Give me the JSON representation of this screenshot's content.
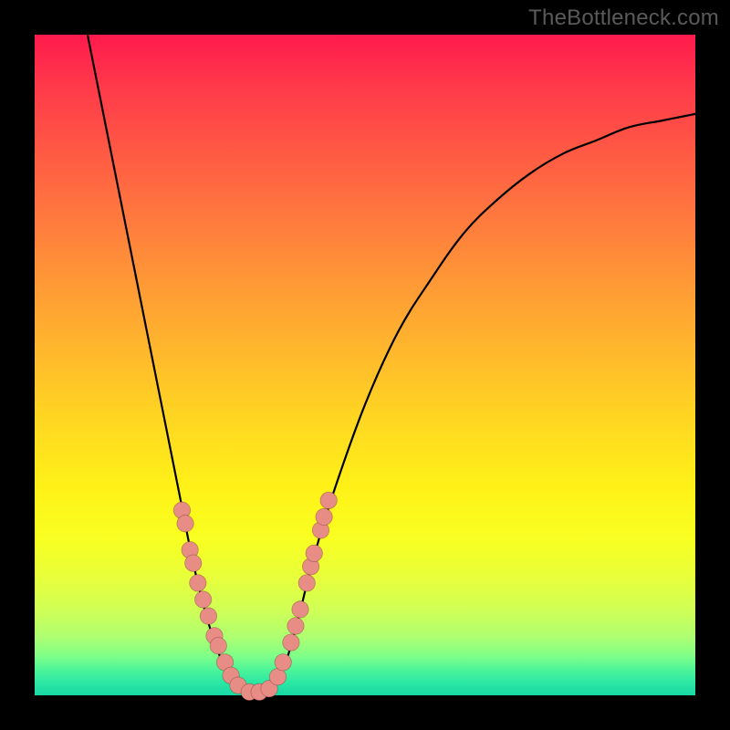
{
  "watermark": "TheBottleneck.com",
  "colors": {
    "frame": "#000000",
    "curve": "#000000",
    "dots": "#e88d86",
    "gradient_top": "#ff1a4d",
    "gradient_bottom": "#18d8a5"
  },
  "chart_data": {
    "type": "line",
    "title": "",
    "xlabel": "",
    "ylabel": "",
    "xlim": [
      0,
      100
    ],
    "ylim": [
      0,
      100
    ],
    "curve": {
      "name": "bottleneck-curve",
      "points": [
        {
          "x": 8,
          "y": 100
        },
        {
          "x": 10,
          "y": 90
        },
        {
          "x": 12,
          "y": 80
        },
        {
          "x": 14,
          "y": 70
        },
        {
          "x": 16,
          "y": 60
        },
        {
          "x": 18,
          "y": 50
        },
        {
          "x": 20,
          "y": 40
        },
        {
          "x": 22,
          "y": 30
        },
        {
          "x": 24,
          "y": 20
        },
        {
          "x": 26,
          "y": 12
        },
        {
          "x": 28,
          "y": 6
        },
        {
          "x": 30,
          "y": 2
        },
        {
          "x": 32,
          "y": 0
        },
        {
          "x": 34,
          "y": 0
        },
        {
          "x": 36,
          "y": 1
        },
        {
          "x": 38,
          "y": 5
        },
        {
          "x": 40,
          "y": 12
        },
        {
          "x": 42,
          "y": 20
        },
        {
          "x": 45,
          "y": 30
        },
        {
          "x": 50,
          "y": 44
        },
        {
          "x": 55,
          "y": 55
        },
        {
          "x": 60,
          "y": 63
        },
        {
          "x": 65,
          "y": 70
        },
        {
          "x": 70,
          "y": 75
        },
        {
          "x": 75,
          "y": 79
        },
        {
          "x": 80,
          "y": 82
        },
        {
          "x": 85,
          "y": 84
        },
        {
          "x": 90,
          "y": 86
        },
        {
          "x": 95,
          "y": 87
        },
        {
          "x": 100,
          "y": 88
        }
      ]
    },
    "dots": [
      {
        "x": 22.3,
        "y": 28
      },
      {
        "x": 22.8,
        "y": 26
      },
      {
        "x": 23.5,
        "y": 22
      },
      {
        "x": 24.0,
        "y": 20
      },
      {
        "x": 24.7,
        "y": 17
      },
      {
        "x": 25.5,
        "y": 14.5
      },
      {
        "x": 26.3,
        "y": 12
      },
      {
        "x": 27.2,
        "y": 9
      },
      {
        "x": 27.8,
        "y": 7.5
      },
      {
        "x": 28.8,
        "y": 5
      },
      {
        "x": 29.7,
        "y": 3
      },
      {
        "x": 30.8,
        "y": 1.5
      },
      {
        "x": 32.5,
        "y": 0.5
      },
      {
        "x": 34.0,
        "y": 0.5
      },
      {
        "x": 35.5,
        "y": 1
      },
      {
        "x": 36.8,
        "y": 2.8
      },
      {
        "x": 37.6,
        "y": 5
      },
      {
        "x": 38.8,
        "y": 8
      },
      {
        "x": 39.5,
        "y": 10.5
      },
      {
        "x": 40.2,
        "y": 13
      },
      {
        "x": 41.2,
        "y": 17
      },
      {
        "x": 41.8,
        "y": 19.5
      },
      {
        "x": 42.3,
        "y": 21.5
      },
      {
        "x": 43.3,
        "y": 25
      },
      {
        "x": 43.8,
        "y": 27
      },
      {
        "x": 44.5,
        "y": 29.5
      }
    ]
  }
}
